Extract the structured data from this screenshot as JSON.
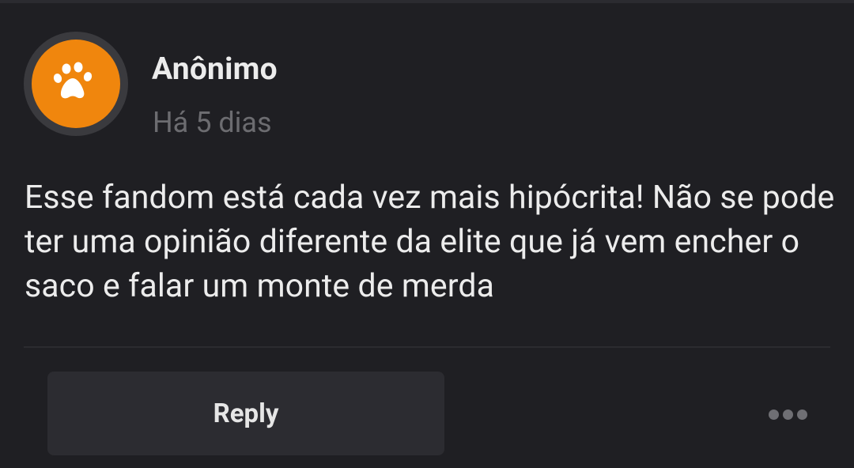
{
  "comment": {
    "author": "Anônimo",
    "timestamp": "Há 5 dias",
    "text": "Esse fandom está cada vez mais hipócrita! Não se pode ter uma opinião diferente da elite que já vem encher o saco e falar um monte de merda",
    "avatar_icon": "paw-icon",
    "avatar_color": "#f0860d"
  },
  "actions": {
    "reply_label": "Reply",
    "more_icon": "more-options-icon"
  },
  "colors": {
    "background": "#1f1f23",
    "button_bg": "#2c2c31",
    "text_primary": "#ececec",
    "text_secondary": "#6c6c70"
  }
}
